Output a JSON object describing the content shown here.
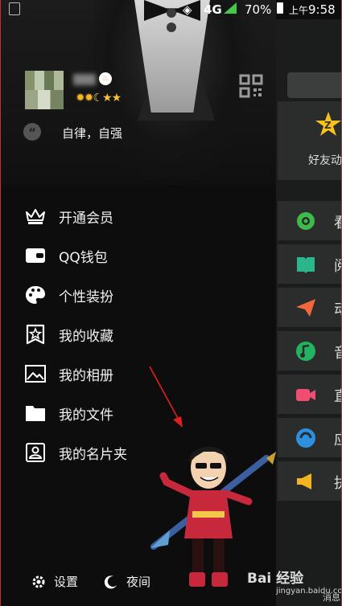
{
  "status_bar": {
    "network": "4G",
    "battery_pct": "70%",
    "time_prefix": "上午",
    "time": "9:58"
  },
  "profile": {
    "signature": "自律，自强",
    "level_icons": [
      "sun",
      "sun",
      "moon",
      "star",
      "star"
    ]
  },
  "menu": {
    "items": [
      {
        "label": "开通会员",
        "icon": "crown-icon"
      },
      {
        "label": "QQ钱包",
        "icon": "wallet-icon"
      },
      {
        "label": "个性装扮",
        "icon": "palette-icon"
      },
      {
        "label": "我的收藏",
        "icon": "favorites-icon"
      },
      {
        "label": "我的相册",
        "icon": "photo-album-icon"
      },
      {
        "label": "我的文件",
        "icon": "folder-icon"
      },
      {
        "label": "我的名片夹",
        "icon": "contact-card-icon"
      }
    ]
  },
  "bottom_bar": {
    "settings_label": "设置",
    "night_label": "夜间"
  },
  "background_page": {
    "card_label": "好友动",
    "rows": [
      {
        "label": "看",
        "color": "#3dbb4a",
        "icon": "eye-icon"
      },
      {
        "label": "阅",
        "color": "#2ab58a",
        "icon": "book-icon"
      },
      {
        "label": "动",
        "color": "#f0683c",
        "icon": "paper-plane-icon"
      },
      {
        "label": "音",
        "color": "#22b360",
        "icon": "music-icon"
      },
      {
        "label": "直",
        "color": "#f04d72",
        "icon": "video-camera-icon"
      },
      {
        "label": "应",
        "color": "#2d8fe0",
        "icon": "apps-icon"
      },
      {
        "label": "执",
        "color": "#f5b41d",
        "icon": "megaphone-icon"
      }
    ],
    "bottom_tab_label": "消息"
  },
  "watermark": {
    "text": "Bai 经验",
    "sub": "jingyan.baidu.com"
  },
  "colors": {
    "drawer_bg": "#0d0d0d",
    "accent_gold": "#f5b623",
    "net_green": "#46c84a"
  }
}
